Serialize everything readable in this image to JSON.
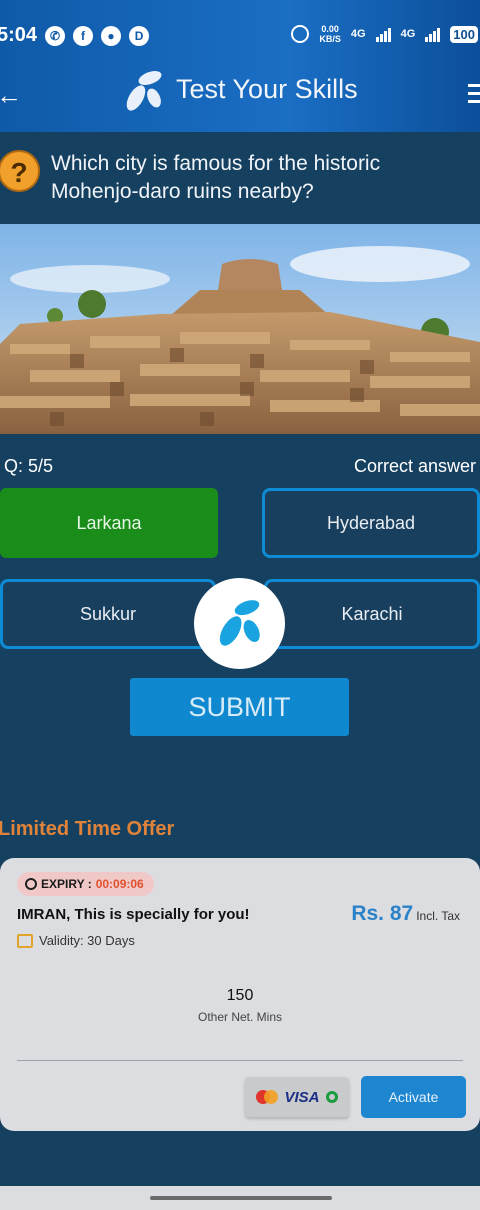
{
  "status_bar": {
    "time": "5:04",
    "net_speed_value": "0.00",
    "net_speed_unit": "KB/S",
    "network_1": "4G",
    "network_2": "4G",
    "battery": "100"
  },
  "header": {
    "title": "Test Your Skills"
  },
  "question": {
    "text": "Which city is famous for the historic Mohenjo-daro ruins nearby?",
    "counter": "Q: 5/5",
    "answer_status": "Correct answer"
  },
  "options": [
    {
      "label": "Larkana",
      "state": "correct"
    },
    {
      "label": "Hyderabad",
      "state": "default"
    },
    {
      "label": "Sukkur",
      "state": "default"
    },
    {
      "label": "Karachi",
      "state": "default"
    }
  ],
  "submit_label": "SUBMIT",
  "offer": {
    "heading": "Limited Time Offer",
    "expiry_label": "EXPIRY :",
    "expiry_time": "00:09:06",
    "title": "IMRAN, This is specially for you!",
    "validity": "Validity: 30 Days",
    "price_value": "Rs. 87",
    "price_note": "Incl. Tax",
    "mins_value": "150",
    "mins_label": "Other Net. Mins",
    "visa_label": "VISA",
    "activate_label": "Activate"
  },
  "colors": {
    "background": "#16405f",
    "header": "#1a6ec4",
    "correct": "#1a8c1a",
    "option_border": "#0f8bd6",
    "submit": "#0f88d0",
    "offer_heading": "#e0833a",
    "price": "#2b82c8"
  },
  "icons": [
    "whatsapp-icon",
    "facebook-icon",
    "alarm-icon",
    "signal-icon",
    "battery-icon",
    "back-arrow-icon",
    "telenor-logo-icon",
    "menu-icon",
    "question-icon",
    "clock-icon",
    "calendar-icon",
    "mastercard-icon",
    "easypaisa-icon"
  ]
}
